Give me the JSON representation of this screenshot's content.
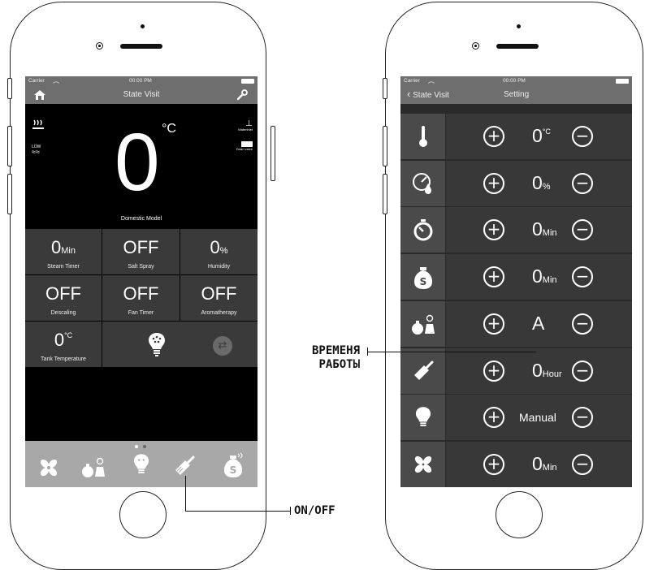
{
  "left_phone": {
    "status": {
      "carrier": "Carrier",
      "time": "00:00 PM"
    },
    "nav": {
      "title": "State Visit",
      "home_icon": "home-icon",
      "settings_icon": "wrench-icon"
    },
    "top_icons": {
      "heater": "heater-icon",
      "low": "LOW",
      "water_inlet": "Waterinlet",
      "drain_valve": "Drain valve"
    },
    "big_temp": {
      "value": "0",
      "unit": "°C",
      "model": "Domestic Model"
    },
    "grid": [
      {
        "value": "0",
        "unit": "Min",
        "label": "Steam Timer"
      },
      {
        "value": "OFF",
        "unit": "",
        "label": "Salt Spray"
      },
      {
        "value": "0",
        "unit": "%",
        "label": "Humidity"
      },
      {
        "value": "OFF",
        "unit": "",
        "label": "Descaling"
      },
      {
        "value": "OFF",
        "unit": "",
        "label": "Fan Timer"
      },
      {
        "value": "OFF",
        "unit": "",
        "label": "Aromatherapy"
      }
    ],
    "tank": {
      "value": "0",
      "unit": "°C",
      "label": "Tank Temperature"
    },
    "dock_icons": [
      "fan-icon",
      "aroma-bottles-icon",
      "lamp-icon",
      "brush-icon",
      "salt-bag-icon"
    ]
  },
  "right_phone": {
    "status": {
      "carrier": "Carrier",
      "time": "00:00 PM"
    },
    "nav": {
      "back": "State Visit",
      "title": "Setting"
    },
    "rows": [
      {
        "icon": "thermometer-icon",
        "value": "0",
        "unit": "°C",
        "unit_pos": "sup"
      },
      {
        "icon": "humidity-gauge-icon",
        "value": "0",
        "unit": "%",
        "unit_pos": "sub"
      },
      {
        "icon": "timer-icon",
        "value": "0",
        "unit": "Min",
        "unit_pos": "sub"
      },
      {
        "icon": "salt-bag-icon",
        "value": "0",
        "unit": "Min",
        "unit_pos": "sub"
      },
      {
        "icon": "aroma-bottles-icon",
        "value": "A",
        "unit": "",
        "unit_pos": "sub"
      },
      {
        "icon": "brush-icon",
        "value": "0",
        "unit": "Hour",
        "unit_pos": "sub"
      },
      {
        "icon": "lamp-icon",
        "value": "Manual",
        "unit": "",
        "unit_pos": "small"
      },
      {
        "icon": "fan-icon",
        "value": "0",
        "unit": "Min",
        "unit_pos": "sub"
      }
    ]
  },
  "annotations": {
    "work_time_line1": "ВРЕМЕНЯ",
    "work_time_line2": "РАБОТЫ",
    "on_off": "ON/OFF"
  }
}
